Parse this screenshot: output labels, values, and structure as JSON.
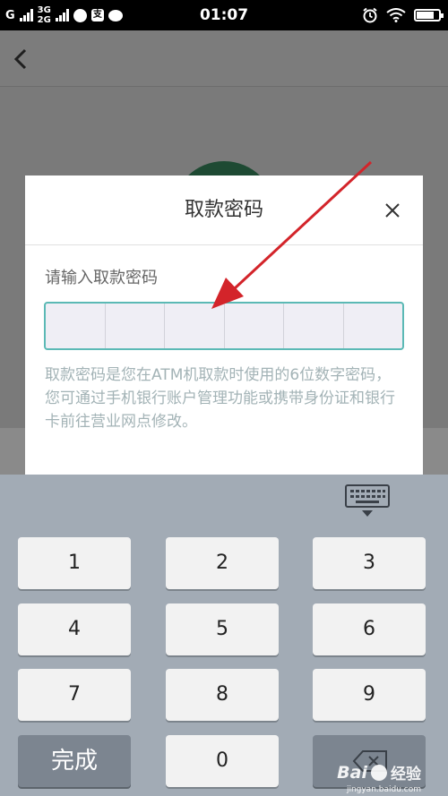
{
  "status_bar": {
    "carrier_1": "G",
    "network_2_top": "3G",
    "network_2_bottom": "2G",
    "app_icon_2": "支",
    "time": "01:07",
    "icons_left": [
      "signal-icon",
      "weibo-icon",
      "alipay-icon",
      "chat-icon"
    ],
    "icons_right": [
      "alarm-icon",
      "wifi-icon",
      "battery-icon"
    ],
    "battery_level": 0.8
  },
  "dialog": {
    "title": "取款密码",
    "prompt": "请输入取款密码",
    "pin_length": 6,
    "hint": "取款密码是您在ATM机取款时使用的6位数字密码，您可通过手机银行账户管理功能或携带身份证和银行卡前往营业网点修改。",
    "close_icon": "close-icon"
  },
  "keyboard": {
    "keys": [
      "1",
      "2",
      "3",
      "4",
      "5",
      "6",
      "7",
      "8",
      "9",
      "完成",
      "0"
    ],
    "done_label": "完成",
    "collapse_icon": "keyboard-hide-icon",
    "backspace_icon": "backspace-icon"
  },
  "watermark": {
    "brand": "Bai",
    "brand_suffix": "经验",
    "domain": "jingyan.baidu.com"
  },
  "colors": {
    "accent": "#5bb9b5",
    "annotation_arrow": "#d3242a",
    "keyboard_bg": "#a2abb5"
  }
}
